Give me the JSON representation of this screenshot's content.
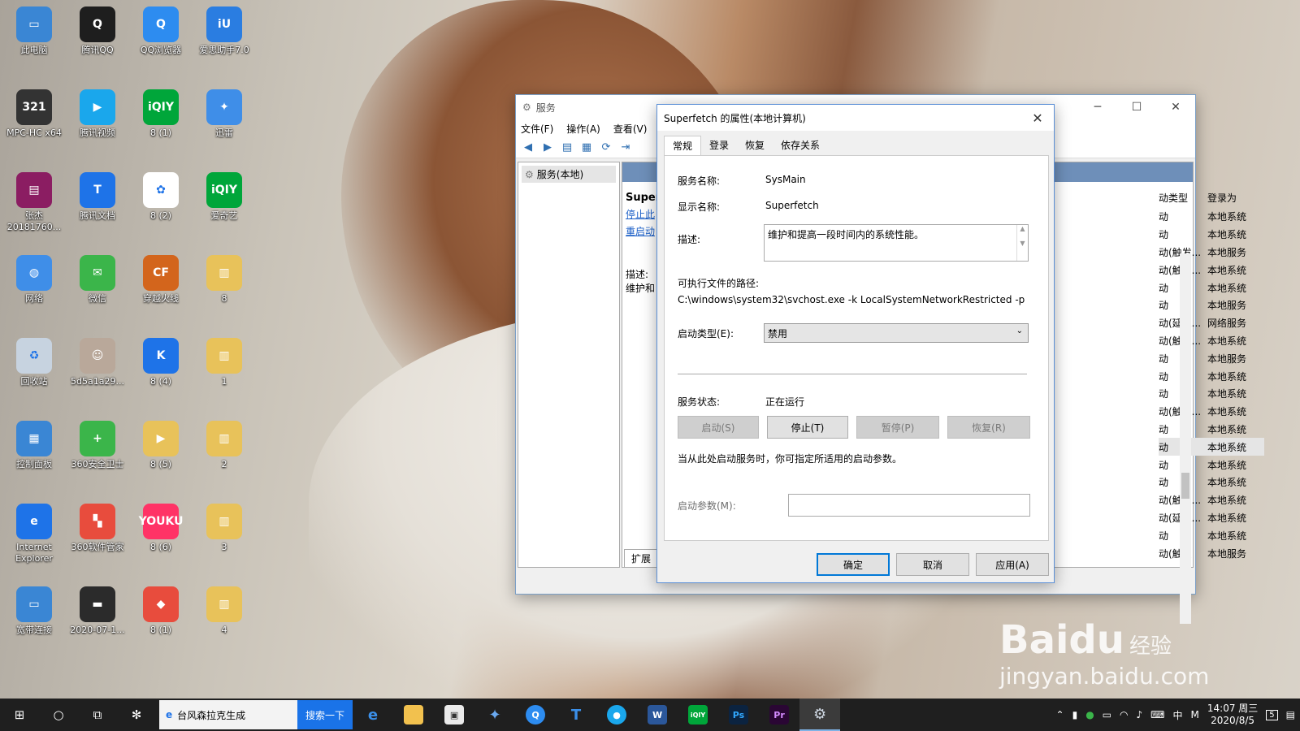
{
  "desktop": {
    "icons": [
      {
        "label": "此电脑",
        "glyph": "▭",
        "color": "#3a86d4"
      },
      {
        "label": "腾讯QQ",
        "glyph": "Q",
        "color": "#1e1e1e"
      },
      {
        "label": "QQ浏览器",
        "glyph": "Q",
        "color": "#2d8cf0"
      },
      {
        "label": "爱思助手7.0",
        "glyph": "iU",
        "color": "#2a7de1"
      },
      {
        "label": "MPC-HC x64",
        "glyph": "321",
        "color": "#333333"
      },
      {
        "label": "腾讯视频",
        "glyph": "▶",
        "color": "#1aa7ec"
      },
      {
        "label": "8 (1)",
        "glyph": "iQIY",
        "color": "#00a63a"
      },
      {
        "label": "迅雷",
        "glyph": "✦",
        "color": "#3f8ee8"
      },
      {
        "label": "张杰 20181760...",
        "glyph": "▤",
        "color": "#8b1d62"
      },
      {
        "label": "腾讯文档",
        "glyph": "T",
        "color": "#1e73e8"
      },
      {
        "label": "8 (2)",
        "glyph": "✿",
        "color": "#ffffff"
      },
      {
        "label": "爱奇艺",
        "glyph": "iQIY",
        "color": "#00a63a"
      },
      {
        "label": "网络",
        "glyph": "◍",
        "color": "#3f8ee8"
      },
      {
        "label": "微信",
        "glyph": "✉",
        "color": "#3bb54a"
      },
      {
        "label": "穿越火线",
        "glyph": "CF",
        "color": "#d3651c"
      },
      {
        "label": "8",
        "glyph": "▥",
        "color": "#e8c25a"
      },
      {
        "label": "回收站",
        "glyph": "♻",
        "color": "#c7d3e0"
      },
      {
        "label": "5d5a1a29...",
        "glyph": "☺",
        "color": "#b9a89a"
      },
      {
        "label": "8 (4)",
        "glyph": "K",
        "color": "#1e73e8"
      },
      {
        "label": "1",
        "glyph": "▥",
        "color": "#e8c25a"
      },
      {
        "label": "控制面板",
        "glyph": "▦",
        "color": "#3a86d4"
      },
      {
        "label": "360安全卫士",
        "glyph": "+",
        "color": "#3bb54a"
      },
      {
        "label": "8 (5)",
        "glyph": "▶",
        "color": "#e8c25a"
      },
      {
        "label": "2",
        "glyph": "▥",
        "color": "#e8c25a"
      },
      {
        "label": "Internet Explorer",
        "glyph": "e",
        "color": "#1e73e8"
      },
      {
        "label": "360软件管家",
        "glyph": "▚",
        "color": "#e84c3d"
      },
      {
        "label": "8 (6)",
        "glyph": "YOUKU",
        "color": "#ff3366"
      },
      {
        "label": "3",
        "glyph": "▥",
        "color": "#e8c25a"
      },
      {
        "label": "宽带连接",
        "glyph": "▭",
        "color": "#3a86d4"
      },
      {
        "label": "2020-07-1...",
        "glyph": "▬",
        "color": "#2b2b2b"
      },
      {
        "label": "8 (1)",
        "glyph": "◆",
        "color": "#e84c3d"
      },
      {
        "label": "4",
        "glyph": "▥",
        "color": "#e8c25a"
      }
    ]
  },
  "services_window": {
    "title": "服务",
    "menu": [
      "文件(F)",
      "操作(A)",
      "查看(V)"
    ],
    "tree_item": "服务(本地)",
    "ext_service_name": "Super",
    "ext_links": [
      "停止此",
      "重启动"
    ],
    "ext_desc_label": "描述:",
    "ext_desc_snippet": "维护和",
    "ext_tab": "扩展",
    "col_headers": [
      "动类型",
      "登录为"
    ],
    "rows": [
      [
        "动",
        "本地系统"
      ],
      [
        "动",
        "本地系统"
      ],
      [
        "动(触发...",
        "本地服务"
      ],
      [
        "动(触发...",
        "本地系统"
      ],
      [
        "动",
        "本地系统"
      ],
      [
        "动",
        "本地服务"
      ],
      [
        "动(延迟...",
        "网络服务"
      ],
      [
        "动(触发...",
        "本地系统"
      ],
      [
        "动",
        "本地服务"
      ],
      [
        "动",
        "本地系统"
      ],
      [
        "动",
        "本地系统"
      ],
      [
        "动(触发...",
        "本地系统"
      ],
      [
        "动",
        "本地系统"
      ],
      [
        "动",
        "本地系统"
      ],
      [
        "动",
        "本地系统"
      ],
      [
        "动",
        "本地系统"
      ],
      [
        "动(触发...",
        "本地系统"
      ],
      [
        "动(延迟...",
        "本地系统"
      ],
      [
        "动",
        "本地系统"
      ],
      [
        "动(触发",
        "本地服务"
      ]
    ],
    "selected_row": 13
  },
  "props_dialog": {
    "title": "Superfetch 的属性(本地计算机)",
    "tabs": [
      "常规",
      "登录",
      "恢复",
      "依存关系"
    ],
    "service_name_label": "服务名称:",
    "service_name": "SysMain",
    "display_name_label": "显示名称:",
    "display_name": "Superfetch",
    "description_label": "描述:",
    "description": "维护和提高一段时间内的系统性能。",
    "exe_path_label": "可执行文件的路径:",
    "exe_path": "C:\\windows\\system32\\svchost.exe -k LocalSystemNetworkRestricted -p",
    "startup_type_label": "启动类型(E):",
    "startup_type": "禁用",
    "status_label": "服务状态:",
    "status": "正在运行",
    "buttons": {
      "start": "启动(S)",
      "stop": "停止(T)",
      "pause": "暂停(P)",
      "resume": "恢复(R)"
    },
    "param_hint": "当从此处启动服务时，你可指定所适用的启动参数。",
    "param_label": "启动参数(M):",
    "param_value": "",
    "ok": "确定",
    "cancel": "取消",
    "apply": "应用(A)"
  },
  "taskbar": {
    "search_text": "台风森拉克生成",
    "search_button": "搜索一下",
    "ime": "中",
    "ime2": "M",
    "time": "14:07 周三",
    "date": "2020/8/5",
    "notif_count": "5"
  },
  "watermark": {
    "brand": "Baidu",
    "brand2": "经验",
    "url": "jingyan.baidu.com"
  }
}
